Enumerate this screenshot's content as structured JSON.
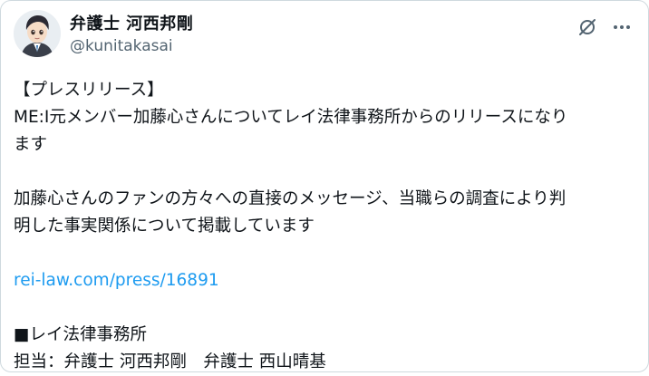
{
  "author": {
    "display_name": "弁護士 河西邦剛",
    "handle": "@kunitakasai"
  },
  "post": {
    "line_title": "【プレスリリース】",
    "line_1": "ME:I元メンバー加藤心さんについてレイ法律事務所からのリリースになり",
    "line_2": "ます",
    "line_3": "加藤心さんのファンの方々への直接のメッセージ、当職らの調査により判",
    "line_4": "明した事実関係について掲載しています",
    "link": "rei-law.com/press/16891",
    "line_5": "■レイ法律事務所",
    "line_6": "担当：弁護士 河西邦剛　弁護士 西山晴基"
  },
  "icons": {
    "mute": "mute-slash-icon",
    "more": "more-dots-icon"
  },
  "colors": {
    "link": "#1d9bf0",
    "text": "#0f1419",
    "secondary": "#536471"
  }
}
